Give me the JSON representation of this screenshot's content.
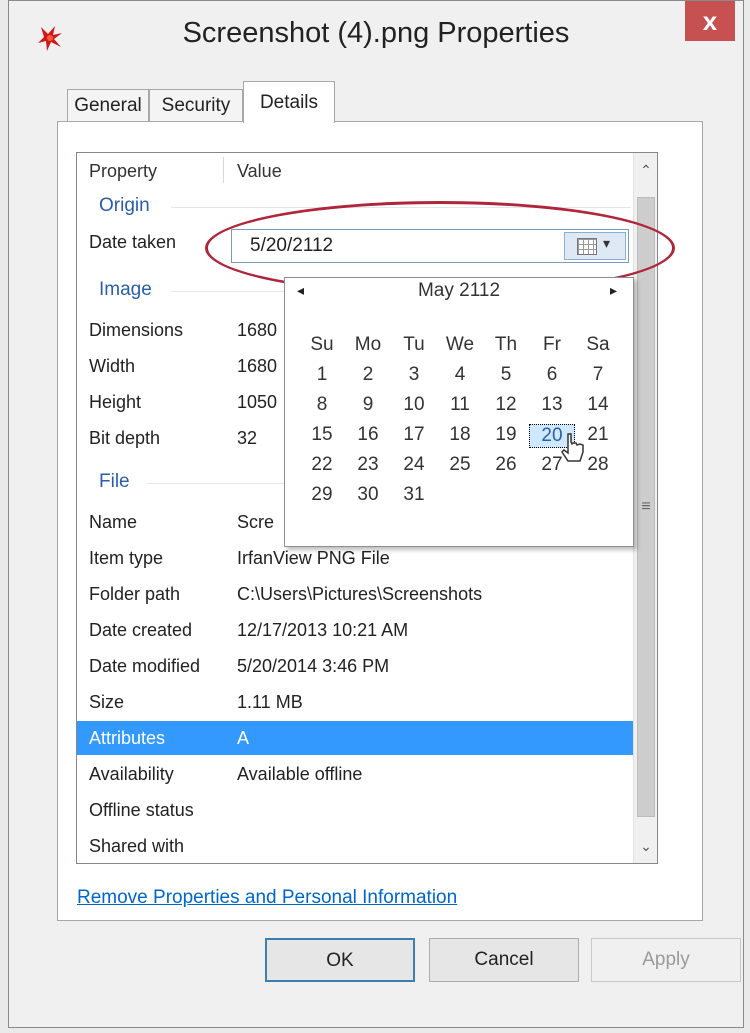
{
  "window": {
    "title": "Screenshot (4).png Properties",
    "close_label": "x"
  },
  "tabs": [
    {
      "label": "General",
      "active": false
    },
    {
      "label": "Security",
      "active": false
    },
    {
      "label": "Details",
      "active": true
    }
  ],
  "grid": {
    "header": {
      "property": "Property",
      "value": "Value"
    },
    "groups": {
      "origin": "Origin",
      "image": "Image",
      "file": "File"
    },
    "date_taken": {
      "label": "Date taken",
      "value": "5/20/2112"
    },
    "image_rows": [
      {
        "name": "Dimensions",
        "value": "1680"
      },
      {
        "name": "Width",
        "value": "1680"
      },
      {
        "name": "Height",
        "value": "1050"
      },
      {
        "name": "Bit depth",
        "value": "32"
      }
    ],
    "file_rows": [
      {
        "name": "Name",
        "value": "Scre"
      },
      {
        "name": "Item type",
        "value": "IrfanView PNG File"
      },
      {
        "name": "Folder path",
        "value": "C:\\Users\\Pictures\\Screenshots"
      },
      {
        "name": "Date created",
        "value": "12/17/2013 10:21 AM"
      },
      {
        "name": "Date modified",
        "value": "5/20/2014 3:46 PM"
      },
      {
        "name": "Size",
        "value": "1.11 MB"
      },
      {
        "name": "Attributes",
        "value": "A",
        "selected": true
      },
      {
        "name": "Availability",
        "value": "Available offline"
      },
      {
        "name": "Offline status",
        "value": ""
      },
      {
        "name": "Shared with",
        "value": ""
      }
    ]
  },
  "calendar": {
    "month_label": "May 2112",
    "prev": "◂",
    "next": "▸",
    "days_of_week": [
      "Su",
      "Mo",
      "Tu",
      "We",
      "Th",
      "Fr",
      "Sa"
    ],
    "weeks": [
      [
        "1",
        "2",
        "3",
        "4",
        "5",
        "6",
        "7"
      ],
      [
        "8",
        "9",
        "10",
        "11",
        "12",
        "13",
        "14"
      ],
      [
        "15",
        "16",
        "17",
        "18",
        "19",
        "20",
        "21"
      ],
      [
        "22",
        "23",
        "24",
        "25",
        "26",
        "27",
        "28"
      ],
      [
        "29",
        "30",
        "31",
        "",
        "",
        "",
        ""
      ]
    ],
    "selected_day": "20"
  },
  "link": {
    "label": "Remove Properties and Personal Information"
  },
  "buttons": {
    "ok": "OK",
    "cancel": "Cancel",
    "apply": "Apply"
  },
  "colors": {
    "selection": "#3399ff",
    "highlight_ring": "#b0253a",
    "link": "#0066cc",
    "close": "#c75050"
  }
}
